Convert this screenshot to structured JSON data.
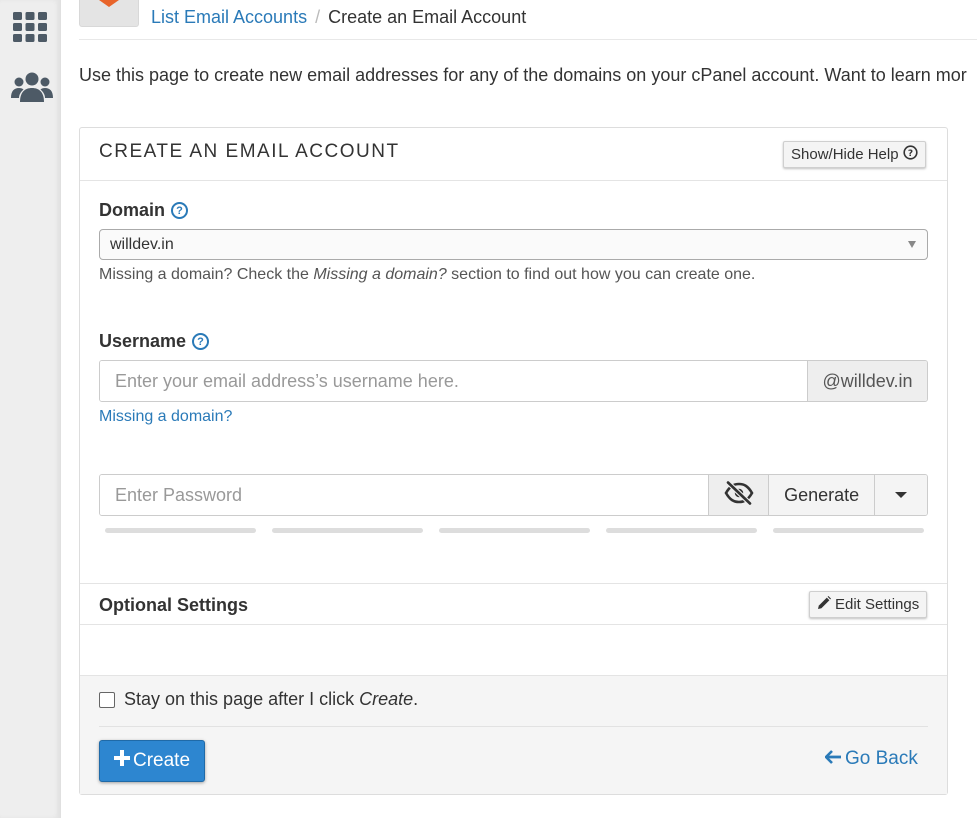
{
  "sidebar": {
    "icons": [
      "apps-grid-icon",
      "users-icon"
    ]
  },
  "breadcrumb": {
    "parent": "List Email Accounts",
    "separator": "/",
    "current": "Create an Email Account"
  },
  "intro": {
    "text": "Use this page to create new email addresses for any of the domains on your cPanel account. Want to learn mor"
  },
  "panel": {
    "title": "CREATE AN EMAIL ACCOUNT",
    "help_button": "Show/Hide Help"
  },
  "domain": {
    "label": "Domain",
    "selected": "willdev.in",
    "help_prefix": "Missing a domain? Check the ",
    "help_emph": "Missing a domain?",
    "help_suffix": " section to find out how you can create one."
  },
  "username": {
    "label": "Username",
    "placeholder": "Enter your email address’s username here.",
    "value": "",
    "suffix": "@willdev.in",
    "missing_link": "Missing a domain?"
  },
  "password": {
    "placeholder": "Enter Password",
    "value": "",
    "generate_label": "Generate"
  },
  "optional": {
    "title": "Optional Settings",
    "edit_button": "Edit Settings"
  },
  "footer": {
    "stay_prefix": "Stay on this page after I click ",
    "stay_emph": "Create",
    "stay_suffix": ".",
    "stay_checked": false,
    "create_button": "Create",
    "go_back": "Go Back"
  },
  "colors": {
    "accent": "#2a7ab8",
    "primary_button": "#2d86d0",
    "logo_orange": "#e8642a"
  }
}
